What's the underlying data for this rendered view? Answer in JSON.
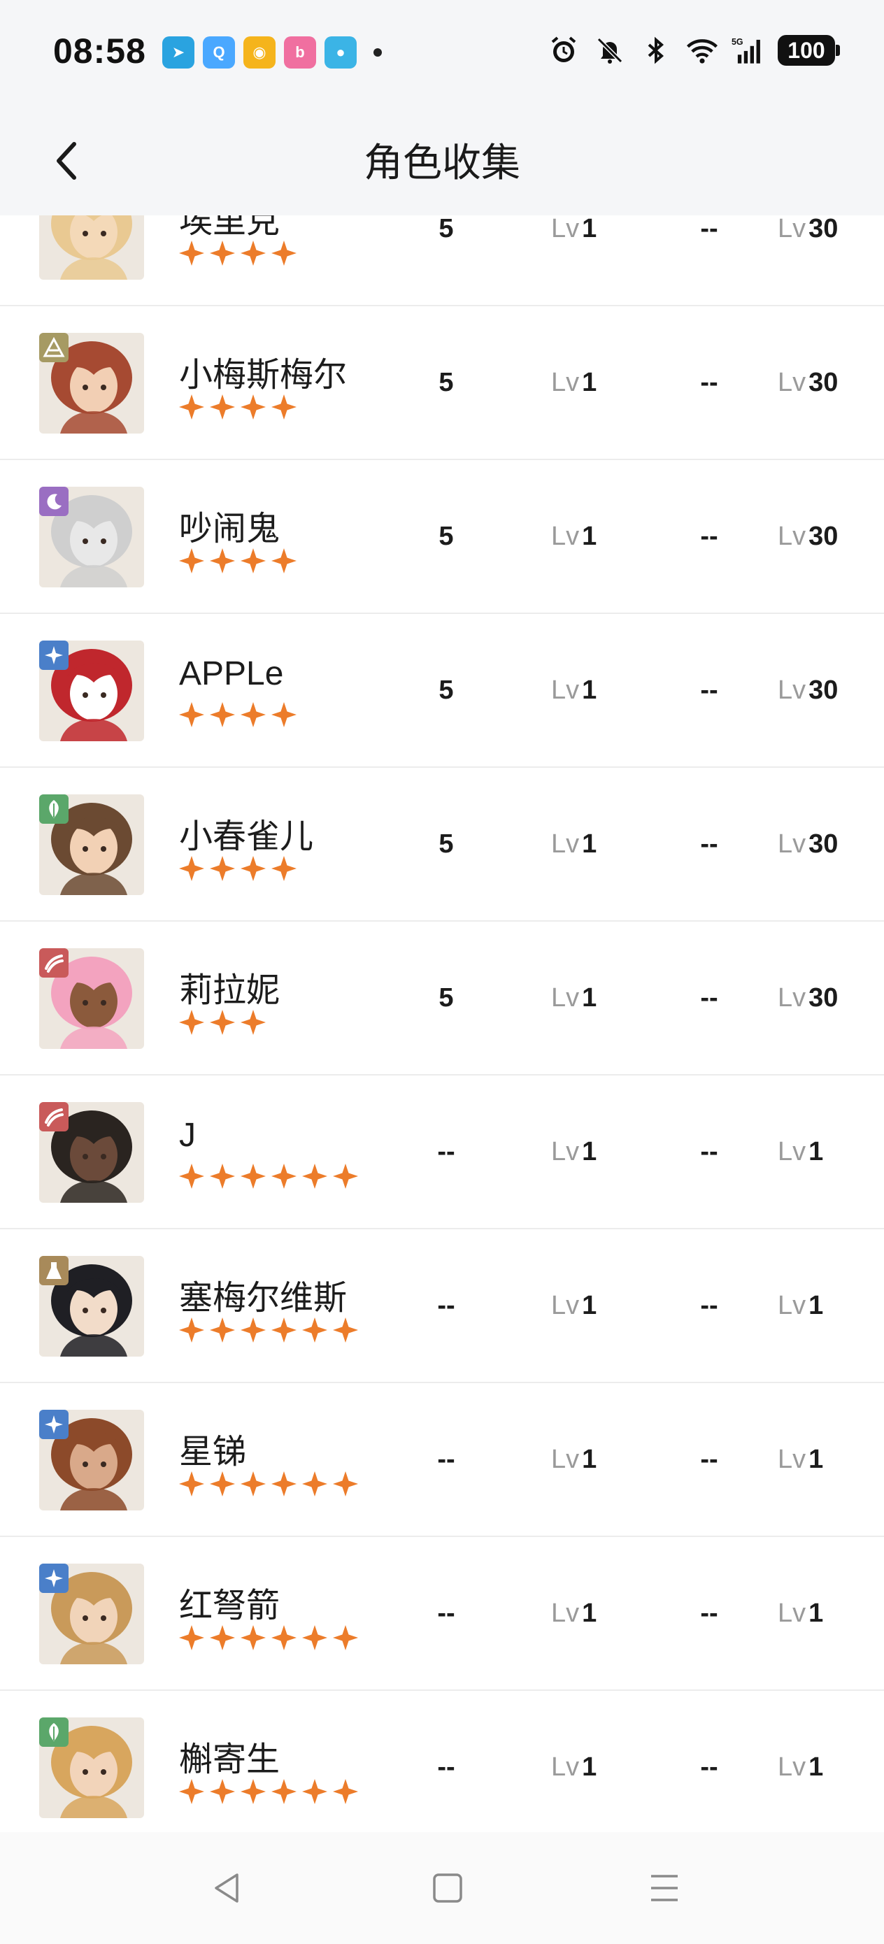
{
  "status_bar": {
    "time": "08:58",
    "notif_icons": [
      {
        "name": "telegram-icon",
        "color": "#2aa3e0",
        "glyph": "➤"
      },
      {
        "name": "qq-icon",
        "color": "#4aa8ff",
        "glyph": "Q"
      },
      {
        "name": "weibo-icon",
        "color": "#f5b41c",
        "glyph": "◉"
      },
      {
        "name": "bilibili-icon",
        "color": "#f06fa0",
        "glyph": "b"
      },
      {
        "name": "bird-app-icon",
        "color": "#3bb4e6",
        "glyph": "●"
      }
    ],
    "network": "5G",
    "battery": "100"
  },
  "header": {
    "title": "角色收集"
  },
  "characters": [
    {
      "name": "埃里克",
      "stars": 4,
      "element": "star",
      "element_color": "#4a7fc9",
      "skin": "#f4d9b8",
      "hair": "#e9c992",
      "c1": "5",
      "c2": "1",
      "c3": "--",
      "c4": "30"
    },
    {
      "name": "小梅斯梅尔",
      "stars": 4,
      "element": "pyramid",
      "element_color": "#a69a63",
      "skin": "#f2cfb4",
      "hair": "#a64a32",
      "c1": "5",
      "c2": "1",
      "c3": "--",
      "c4": "30"
    },
    {
      "name": "吵闹鬼",
      "stars": 4,
      "element": "moon",
      "element_color": "#9a6ec2",
      "skin": "#e8e8e8",
      "hair": "#cfcfcf",
      "c1": "5",
      "c2": "1",
      "c3": "--",
      "c4": "30"
    },
    {
      "name": "APPLe",
      "stars": 4,
      "element": "star",
      "element_color": "#4a7fc9",
      "skin": "#ffffff",
      "hair": "#c0272d",
      "c1": "5",
      "c2": "1",
      "c3": "--",
      "c4": "30"
    },
    {
      "name": "小春雀儿",
      "stars": 4,
      "element": "leaf",
      "element_color": "#5ba76a",
      "skin": "#f2d1b5",
      "hair": "#6b4a32",
      "c1": "5",
      "c2": "1",
      "c3": "--",
      "c4": "30"
    },
    {
      "name": "莉拉妮",
      "stars": 3,
      "element": "claw",
      "element_color": "#c95a5a",
      "skin": "#8b5a3c",
      "hair": "#f3a3bf",
      "c1": "5",
      "c2": "1",
      "c3": "--",
      "c4": "30"
    },
    {
      "name": "J",
      "stars": 6,
      "element": "claw",
      "element_color": "#c95a5a",
      "skin": "#6b4a3a",
      "hair": "#2a2420",
      "c1": "--",
      "c2": "1",
      "c3": "--",
      "c4": "1"
    },
    {
      "name": "塞梅尔维斯",
      "stars": 6,
      "element": "flask",
      "element_color": "#a88a5a",
      "skin": "#f2dcc9",
      "hair": "#1f1f24",
      "c1": "--",
      "c2": "1",
      "c3": "--",
      "c4": "1"
    },
    {
      "name": "星锑",
      "stars": 6,
      "element": "star",
      "element_color": "#4a7fc9",
      "skin": "#d9a98a",
      "hair": "#8c4a2a",
      "c1": "--",
      "c2": "1",
      "c3": "--",
      "c4": "1"
    },
    {
      "name": "红弩箭",
      "stars": 6,
      "element": "star",
      "element_color": "#4a7fc9",
      "skin": "#f1d4b9",
      "hair": "#c99a5a",
      "c1": "--",
      "c2": "1",
      "c3": "--",
      "c4": "1"
    },
    {
      "name": "槲寄生",
      "stars": 6,
      "element": "leaf",
      "element_color": "#5ba76a",
      "skin": "#f2d4ba",
      "hair": "#d8a65e",
      "c1": "--",
      "c2": "1",
      "c3": "--",
      "c4": "1"
    }
  ],
  "labels": {
    "lv": "Lv"
  }
}
